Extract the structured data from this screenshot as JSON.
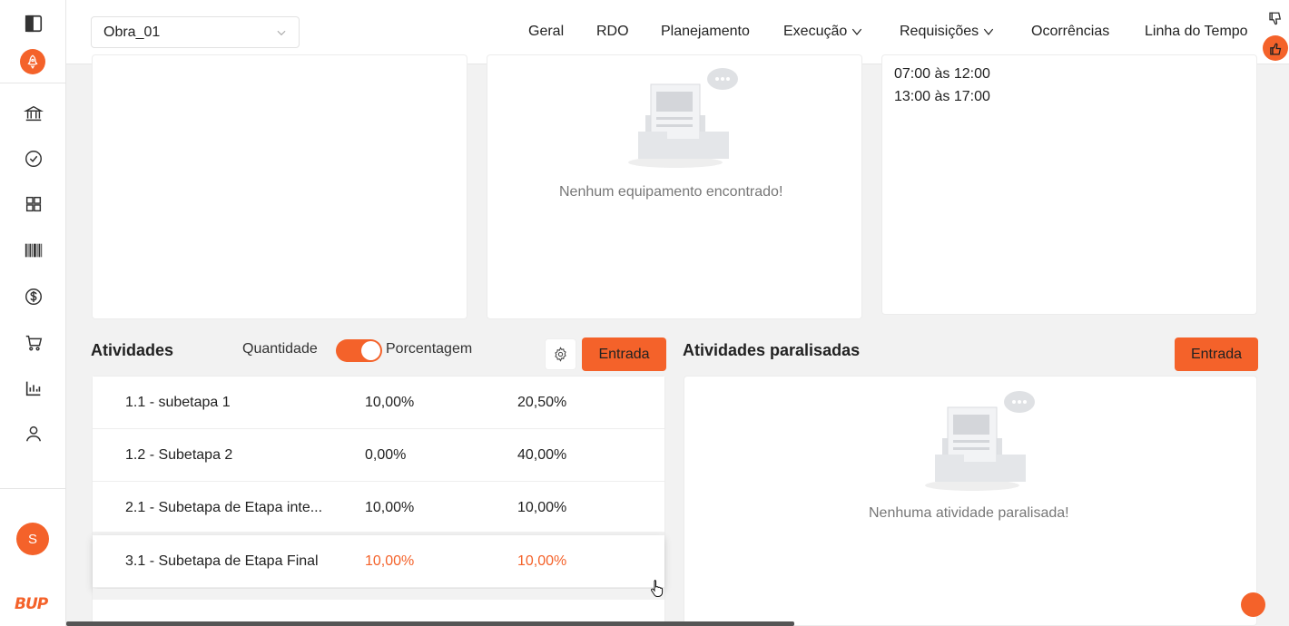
{
  "header": {
    "obra_select": "Obra_01",
    "nav": {
      "geral": "Geral",
      "rdo": "RDO",
      "planejamento": "Planejamento",
      "execucao": "Execução",
      "requisicoes": "Requisições",
      "ocorrencias": "Ocorrências",
      "linha_do_tempo": "Linha do Tempo"
    }
  },
  "sidebar": {
    "icons": [
      "panel-toggle-icon",
      "rocket-icon",
      "bank-icon",
      "check-circle-icon",
      "grid-icon",
      "barcode-icon",
      "dollar-icon",
      "cart-icon",
      "bar-chart-icon",
      "user-icon"
    ],
    "avatar_initial": "S",
    "logo_text": "BUP"
  },
  "equipment": {
    "empty_text": "Nenhum equipamento encontrado!"
  },
  "schedule": {
    "hours": [
      "07:00 às 12:00",
      "13:00 às 17:00"
    ]
  },
  "activities": {
    "title": "Atividades",
    "toggle_left": "Quantidade",
    "toggle_right": "Porcentagem",
    "entry_button": "Entrada",
    "rows": [
      {
        "name": "1.1 - subetapa 1",
        "v1": "10,00%",
        "v2": "20,50%"
      },
      {
        "name": "1.2 - Subetapa 2",
        "v1": "0,00%",
        "v2": "40,00%"
      },
      {
        "name": "2.1 - Subetapa de Etapa inte...",
        "v1": "10,00%",
        "v2": "10,00%"
      },
      {
        "name": "3.1 - Subetapa de Etapa Final",
        "v1": "10,00%",
        "v2": "10,00%"
      }
    ]
  },
  "paused": {
    "title": "Atividades paralisadas",
    "entry_button": "Entrada",
    "empty_text": "Nenhuma atividade paralisada!"
  },
  "colors": {
    "accent": "#f4622a"
  }
}
